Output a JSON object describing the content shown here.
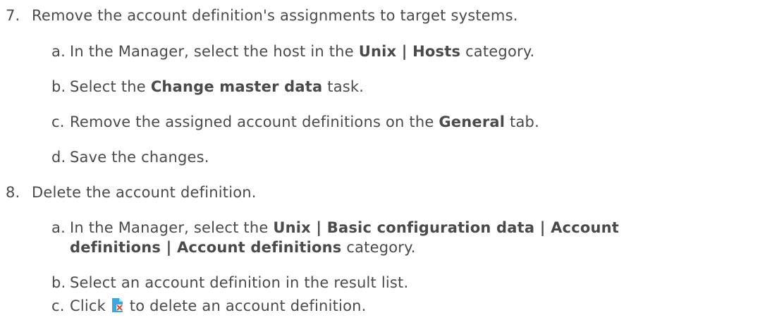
{
  "steps": [
    {
      "number": "7.",
      "text": "Remove the account definition's assignments to target systems.",
      "substeps": [
        {
          "letter": "a.",
          "pre": "In the Manager, select the host in the ",
          "bold": "Unix | Hosts",
          "post": " category."
        },
        {
          "letter": "b.",
          "pre": "Select the ",
          "bold": "Change master data",
          "post": " task."
        },
        {
          "letter": "c.",
          "pre": "Remove the assigned account definitions on the ",
          "bold": "General",
          "post": " tab."
        },
        {
          "letter": "d.",
          "pre": "Save the changes."
        }
      ]
    },
    {
      "number": "8.",
      "text": "Delete the account definition.",
      "substeps": [
        {
          "letter": "a.",
          "pre": "In the Manager, select the ",
          "bold": "Unix | Basic configuration data | Account",
          "bold2": "definitions | Account definitions",
          "post": " category."
        },
        {
          "letter": "b.",
          "pre": "Select an account definition in the result list."
        },
        {
          "letter": "c.",
          "pre": "Click ",
          "icon": "delete-account-definition-icon",
          "post": " to delete an account definition."
        }
      ]
    }
  ],
  "colors": {
    "text": "#4a4a4a",
    "icon_blue": "#3aa8e0",
    "icon_red": "#e04a3c"
  }
}
